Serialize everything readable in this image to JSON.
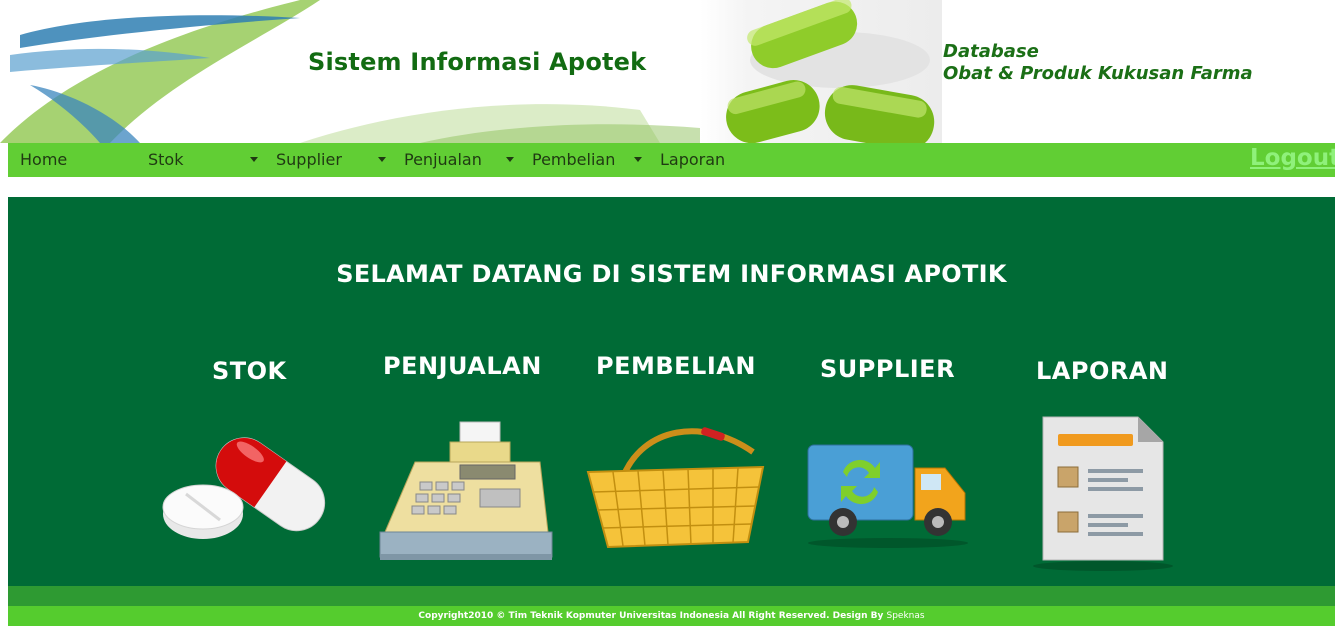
{
  "header": {
    "title": "Sistem Informasi Apotek",
    "db_line1": "Database",
    "db_line2": "Obat & Produk Kukusan Farma"
  },
  "nav": {
    "items": [
      {
        "label": "Home",
        "dropdown": false
      },
      {
        "label": "Stok",
        "dropdown": true
      },
      {
        "label": "Supplier",
        "dropdown": true
      },
      {
        "label": "Penjualan",
        "dropdown": true
      },
      {
        "label": "Pembelian",
        "dropdown": true
      },
      {
        "label": "Laporan",
        "dropdown": false
      }
    ],
    "logout": "Logout"
  },
  "main": {
    "welcome": "SELAMAT DATANG DI SISTEM INFORMASI APOTIK",
    "tiles": [
      {
        "label": "STOK",
        "icon": "pills-icon"
      },
      {
        "label": "PENJUALAN",
        "icon": "cash-register-icon"
      },
      {
        "label": "PEMBELIAN",
        "icon": "shopping-basket-icon"
      },
      {
        "label": "SUPPLIER",
        "icon": "delivery-truck-icon"
      },
      {
        "label": "LAPORAN",
        "icon": "report-document-icon"
      }
    ]
  },
  "footer": {
    "copyright": "Copyright2010 © Tim Teknik Kopmuter Universitas Indonesia All Right Reserved.  Design By ",
    "designer": "Speknas"
  },
  "colors": {
    "nav_bg": "#61ce34",
    "main_bg": "#006b36",
    "title_green": "#126b12",
    "logout": "#8ff17b",
    "footer_bg": "#55cc2e"
  }
}
